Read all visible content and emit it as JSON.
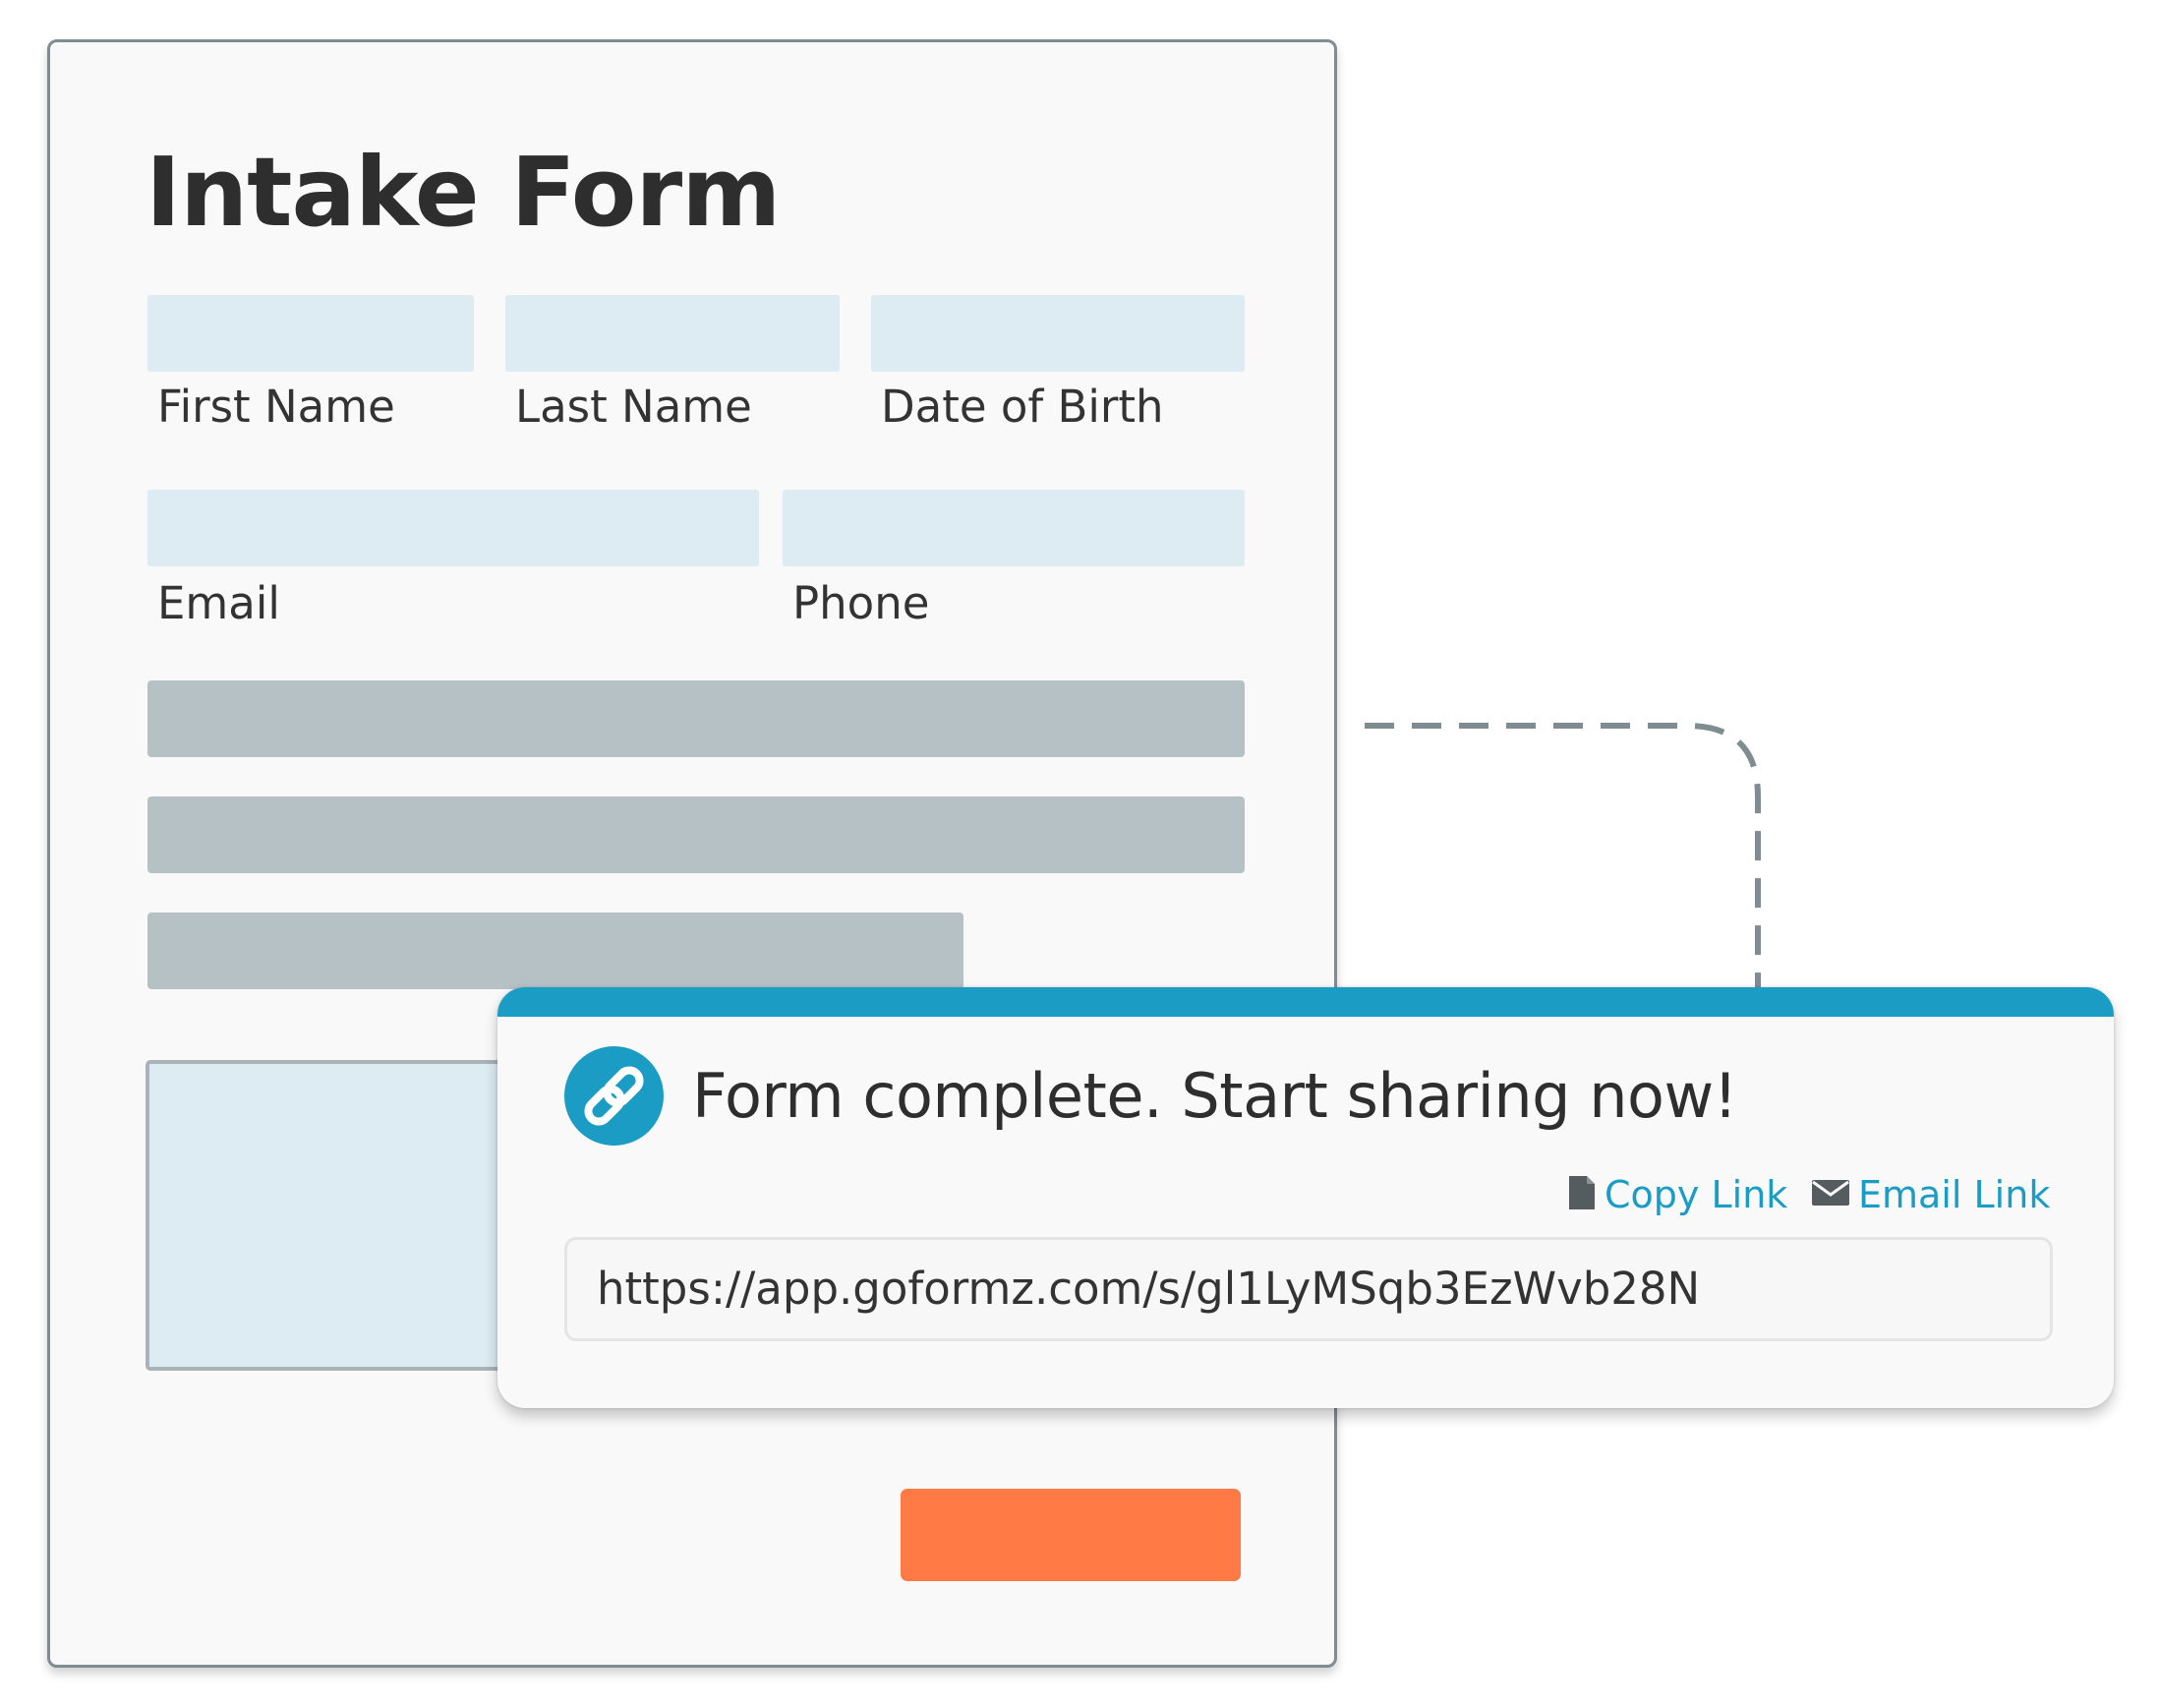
{
  "form": {
    "title": "Intake Form",
    "fields": {
      "first_name_label": "First Name",
      "last_name_label": "Last Name",
      "date_of_birth_label": "Date of Birth",
      "email_label": "Email",
      "phone_label": "Phone"
    }
  },
  "share_popup": {
    "heading": "Form complete. Start sharing now!",
    "icon": "link-icon",
    "copy_link_label": "Copy Link",
    "copy_link_icon": "document-icon",
    "email_link_label": "Email Link",
    "email_link_icon": "envelope-icon",
    "share_url": "https://app.goformz.com/s/gl1LyMSqb3EzWvb28N"
  },
  "colors": {
    "accent_blue": "#1a9cc4",
    "submit_orange": "#ff7a45",
    "field_fill": "#dcecf2",
    "placeholder_gray": "#b6c1c5"
  }
}
